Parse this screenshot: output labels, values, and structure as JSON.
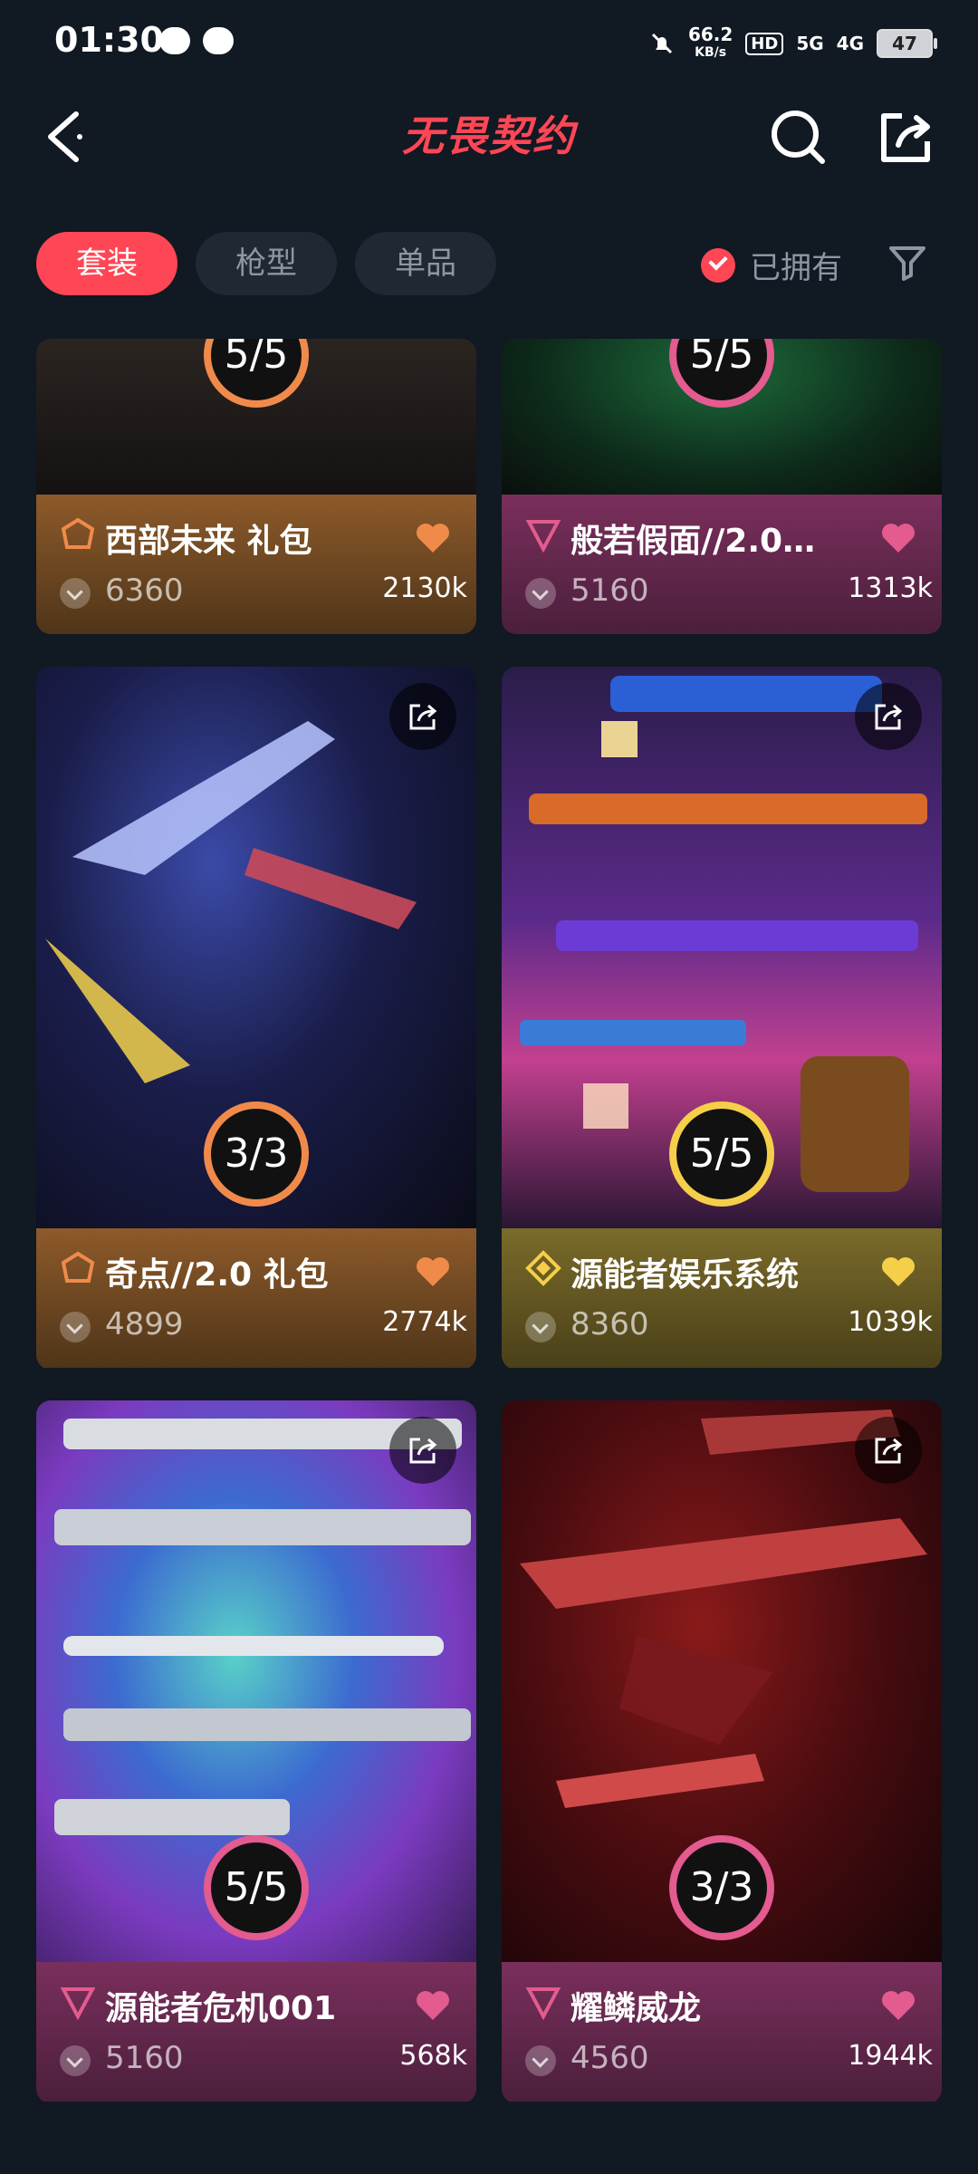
{
  "status_bar": {
    "time": "01:30",
    "net_speed_value": "66.2",
    "net_speed_unit": "KB/s",
    "hd_badge": "HD",
    "sim1": "5G",
    "sim2": "4G",
    "battery": "47"
  },
  "header": {
    "title": "无畏契约"
  },
  "tabs": [
    {
      "label": "套装",
      "active": true
    },
    {
      "label": "枪型",
      "active": false
    },
    {
      "label": "单品",
      "active": false
    }
  ],
  "filter": {
    "owned_label": "已拥有"
  },
  "cards": [
    {
      "name": "西部未来 礼包",
      "price": "6360",
      "likes": "2130k",
      "progress": "5/5",
      "tier": "orange"
    },
    {
      "name": "般若假面//2.0…",
      "price": "5160",
      "likes": "1313k",
      "progress": "5/5",
      "tier": "pink"
    },
    {
      "name": "奇点//2.0 礼包",
      "price": "4899",
      "likes": "2774k",
      "progress": "3/3",
      "tier": "orange"
    },
    {
      "name": "源能者娱乐系统",
      "price": "8360",
      "likes": "1039k",
      "progress": "5/5",
      "tier": "yellow"
    },
    {
      "name": "源能者危机001",
      "price": "5160",
      "likes": "568k",
      "progress": "5/5",
      "tier": "pink"
    },
    {
      "name": "耀鳞威龙",
      "price": "4560",
      "likes": "1944k",
      "progress": "3/3",
      "tier": "pink"
    }
  ],
  "colors": {
    "accent": "#ff4655",
    "background": "#111923",
    "orange_tier": "#f08a4b",
    "pink_tier": "#e35b8f",
    "yellow_tier": "#f5cf4a"
  }
}
